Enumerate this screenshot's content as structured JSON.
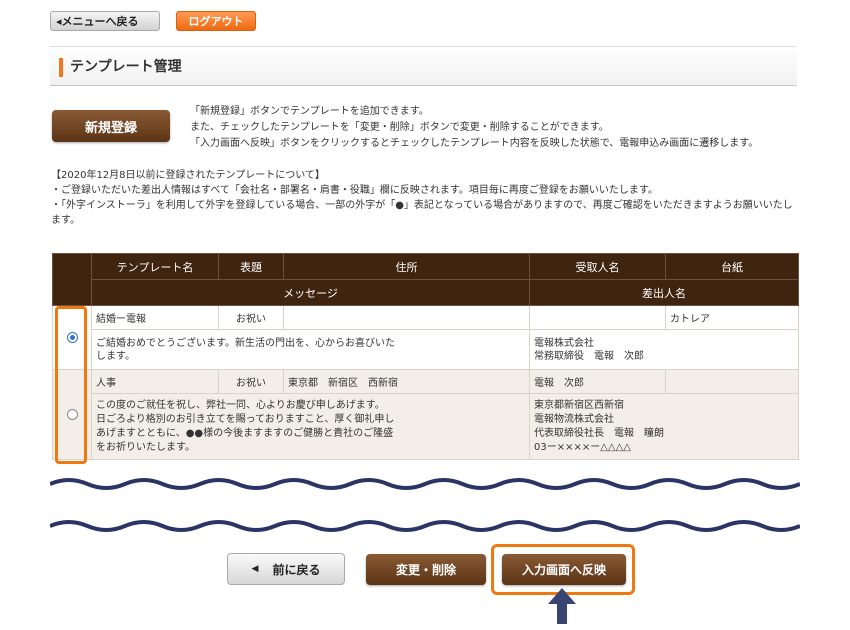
{
  "top": {
    "back_menu_label": "◂メニューへ戻る",
    "logout_label": "ログアウト"
  },
  "page_title": "テンプレート管理",
  "new_register_label": "新規登録",
  "info_lines": [
    "「新規登録」ボタンでテンプレートを追加できます。",
    "また、チェックしたテンプレートを「変更・削除」ボタンで変更・削除することができます。",
    "「入力画面へ反映」ボタンをクリックするとチェックしたテンプレート内容を反映した状態で、電報申込み画面に遷移します。"
  ],
  "notice_lines": [
    "【2020年12月8日以前に登録されたテンプレートについて】",
    "・ご登録いただいた差出人情報はすべて「会社名・部署名・肩書・役職」欄に反映されます。項目毎に再度ご登録をお願いいたします。",
    "・「外字インストーラ」を利用して外字を登録している場合、一部の外字が「●」表記となっている場合がありますので、再度ご確認をいただきますようお願いいたします。"
  ],
  "table": {
    "headers": {
      "template_name": "テンプレート名",
      "title": "表題",
      "address": "住所",
      "recipient": "受取人名",
      "mount": "台紙",
      "message": "メッセージ",
      "sender": "差出人名"
    },
    "rows": [
      {
        "selected": true,
        "template_name": "結婚ー電報",
        "title": "お祝い",
        "address": "",
        "recipient": "",
        "mount": "カトレア",
        "message": [
          "ご結婚おめでとうございます。新生活の門出を、心からお喜びいた",
          "します。"
        ],
        "sender": [
          "電報株式会社",
          "常務取締役　電報　次郎"
        ]
      },
      {
        "selected": false,
        "template_name": "人事",
        "title": "お祝い",
        "address": "東京都　新宿区　西新宿",
        "recipient": "電報　次郎",
        "mount": "",
        "message": [
          "この度のご就任を祝し、弊社一同、心よりお慶び申しあげます。",
          "日ごろより格別のお引き立てを賜っておりますこと、厚く御礼申し",
          "あげますとともに、●●様の今後ますますのご健勝と貴社のご隆盛",
          "をお祈りいたします。"
        ],
        "sender": [
          "東京都新宿区西新宿",
          "電報物流株式会社",
          "代表取締役社長　電報　瞳朗",
          "03ー××××ー△△△△"
        ]
      }
    ]
  },
  "bottom": {
    "prev_label": "前に戻る",
    "change_delete_label": "変更・削除",
    "reflect_label": "入力画面へ反映"
  },
  "colors": {
    "accent_orange": "#f07810",
    "header_brown": "#3f2510",
    "button_brown": "#6b4120",
    "wave_navy": "#2a3566",
    "arrow_navy": "#3a4472"
  }
}
